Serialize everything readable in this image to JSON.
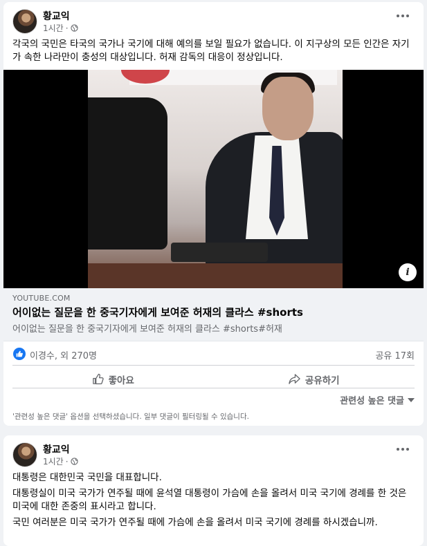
{
  "posts": [
    {
      "author": "황교익",
      "time": "1시간",
      "visibility_icon": "globe-icon",
      "text": "각국의 국민은 타국의 국가나 국기에 대해 예의를 보일 필요가 없습니다. 이 지구상의 모든 인간은 자기가 속한 나라만이 충성의 대상입니다. 허재 감독의 대응이 정상입니다.",
      "link": {
        "domain": "YOUTUBE.COM",
        "title": "어이없는 질문을 한 중국기자에게 보여준 허재의 클라스 #shorts",
        "description": "어이없는 질문을 한 중국기자에게 보여준 허재의 클라스 #shorts#허재"
      },
      "reactions": {
        "icon": "like-icon",
        "names": "이경수, 외 270명"
      },
      "shares": "공유 17회",
      "actions": {
        "like": "좋아요",
        "share": "공유하기"
      },
      "comment_sort": "관련성 높은 댓글",
      "comment_notice": "'관련성 높은 댓글' 옵션을 선택하셨습니다. 일부 댓글이 필터링될 수 있습니다."
    },
    {
      "author": "황교익",
      "time": "1시간",
      "visibility_icon": "globe-icon",
      "paragraphs": [
        "대통령은 대한민국 국민을 대표합니다.",
        "대통령실이 미국 국가가 연주될 때에 윤석열 대통령이 가슴에 손을 올려서 미국 국기에 경례를 한 것은 미국에 대한 존중의 표시라고 합니다.",
        "국민 여러분은 미국 국가가 연주될 때에 가슴에 손을 올려서 미국 국기에 경례를 하시겠습니까."
      ]
    }
  ],
  "colors": {
    "accent": "#1877f2",
    "secondary_text": "#65676b",
    "background": "#f0f2f5"
  }
}
